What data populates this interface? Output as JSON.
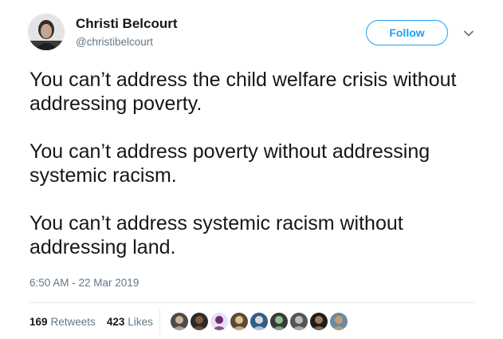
{
  "author": {
    "name": "Christi Belcourt",
    "handle": "@christibelcourt"
  },
  "follow_label": "Follow",
  "tweet_paragraphs": [
    "You can’t address the child welfare crisis without addressing poverty.",
    "You can’t address poverty without addressing systemic racism.",
    "You can’t address systemic racism without addressing land."
  ],
  "timestamp": "6:50 AM - 22 Mar 2019",
  "stats": {
    "retweets_count": "169",
    "retweets_label": "Retweets",
    "likes_count": "423",
    "likes_label": "Likes"
  },
  "colors": {
    "accent": "#1da1f2",
    "text": "#14171a",
    "secondary": "#657786"
  },
  "liker_avatars": [
    {
      "bg": "#4a4a4a",
      "fg": "#c9b39a"
    },
    {
      "bg": "#2b2b2b",
      "fg": "#7a5c44"
    },
    {
      "bg": "#e8e0f0",
      "fg": "#6b2c6e"
    },
    {
      "bg": "#5a4a3a",
      "fg": "#e0c090"
    },
    {
      "bg": "#2f5f8a",
      "fg": "#d8d8d8"
    },
    {
      "bg": "#3a3a3a",
      "fg": "#8fbf8f"
    },
    {
      "bg": "#555555",
      "fg": "#bdbdbd"
    },
    {
      "bg": "#1e1e1e",
      "fg": "#9a7a5a"
    },
    {
      "bg": "#6a8aa0",
      "fg": "#c0a070"
    }
  ]
}
